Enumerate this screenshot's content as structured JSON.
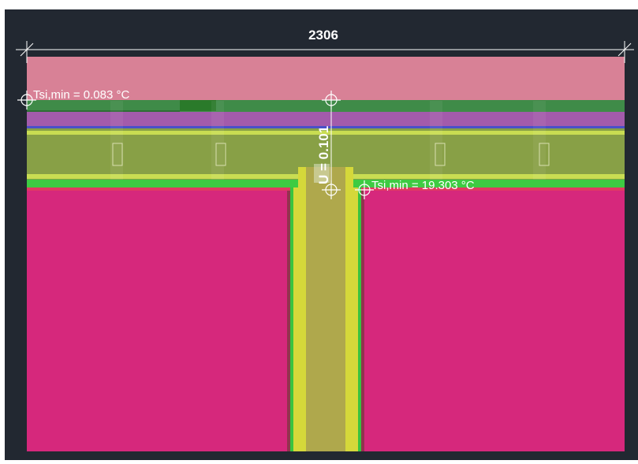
{
  "drawing": {
    "dimension_label": "2306",
    "annotations": {
      "tsi_min_left": "Tsi,min = 0.083 °C",
      "tsi_min_right": "Tsi,min = 19.303 °C",
      "u_value": "U = 0.101"
    }
  },
  "colors": {
    "background": "#222831",
    "outer_band": "#d88196",
    "green_layer": "#3f8b48",
    "dark_green_accent": "#2a7a2a",
    "purple_layer": "#a35bab",
    "blue_line": "#4a50c8",
    "olive_insulation": "#88a046",
    "yellow_green_line": "#c9dd52",
    "bright_green": "#3ecb42",
    "red_line": "#e03a62",
    "magenta_fill": "#d6287c",
    "column_olive": "#afa84c",
    "column_yellow": "#d5d83a",
    "column_green": "#39c340",
    "annotation_text": "#ffffff"
  }
}
